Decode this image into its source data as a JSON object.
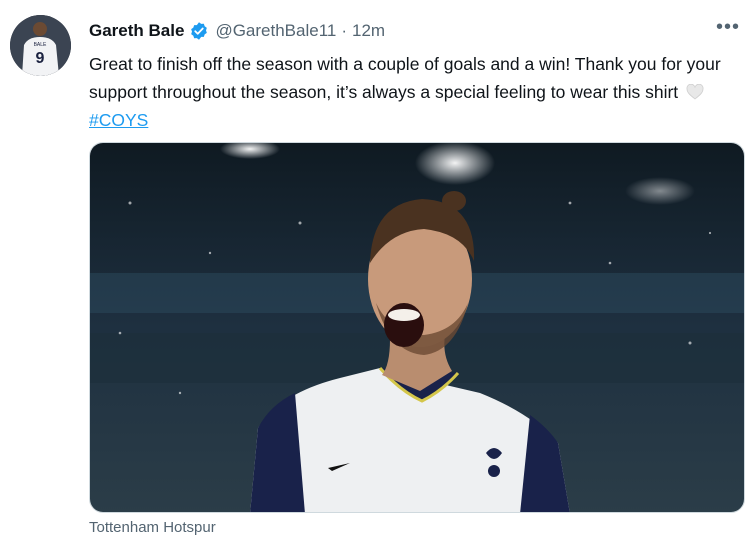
{
  "tweet": {
    "author_name": "Gareth Bale",
    "handle": "@GarethBale11",
    "separator": "·",
    "time": "12m",
    "more_label": "•••",
    "text_main": "Great to finish off the season with a couple of goals and a win! Thank you for your support throughout the season, it’s always a special feeling to wear this shirt",
    "emoji": "white-heart",
    "hashtag": "#COYS",
    "media_caption": "Tottenham Hotspur"
  },
  "avatar": {
    "shirt_number": "9",
    "shirt_name": "BALE"
  },
  "colors": {
    "accent": "#1d9bf0",
    "text": "#0f1419",
    "secondary": "#536471"
  },
  "icons": [
    "verified-badge-icon",
    "more-icon",
    "white-heart-emoji-icon"
  ]
}
